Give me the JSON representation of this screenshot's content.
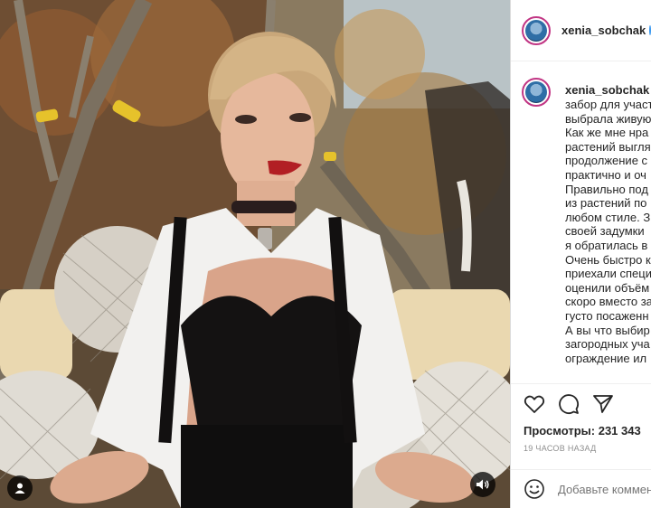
{
  "header": {
    "username": "xenia_sobchak"
  },
  "caption": {
    "username": "xenia_sobchak",
    "lines": [
      "забор для участ",
      "выбрала живую",
      "Как же мне нра",
      "растений выгля",
      "продолжение с",
      "практично и оч",
      "Правильно под",
      "из растений по",
      "любом стиле. З",
      "своей задумки",
      "я обратилась в",
      "Очень быстро к",
      "приехали специ",
      "оценили объём",
      "скоро вместо за",
      "густо посаженн",
      "А вы что выбир",
      "загородных уча",
      "ограждение ил"
    ]
  },
  "stats": {
    "views_label": "Просмотры:",
    "views_value": "231 343",
    "time": "19 ЧАСОВ НАЗАД"
  },
  "comment": {
    "placeholder": "Добавьте коммен"
  },
  "icons": {
    "like": "heart-icon",
    "comment": "comment-icon",
    "share": "share-icon",
    "emoji": "emoji-icon",
    "profile": "user-icon",
    "sound": "speaker-icon"
  }
}
